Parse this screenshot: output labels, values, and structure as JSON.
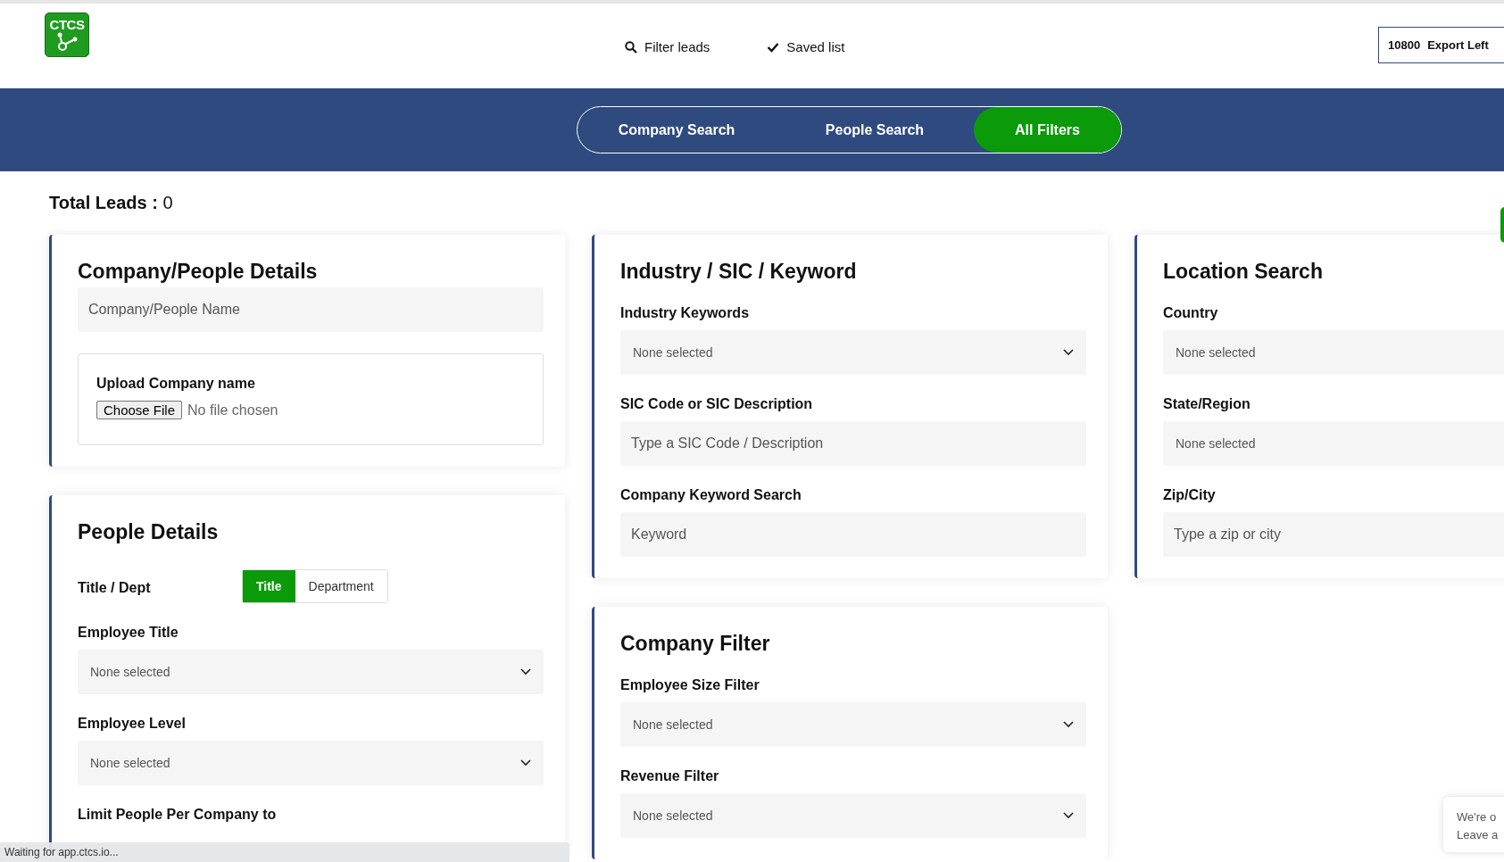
{
  "header": {
    "logo": "CTCS",
    "nav": [
      {
        "label": "Filter leads",
        "kind": "search"
      },
      {
        "label": "Saved list",
        "kind": "check"
      }
    ],
    "export": {
      "count": "10800",
      "label": "Export Left"
    }
  },
  "search_tabs": [
    {
      "label": "Company Search",
      "selected": false
    },
    {
      "label": "People Search",
      "selected": false
    },
    {
      "label": "All Filters",
      "selected": true
    }
  ],
  "total_leads": {
    "label": "Total Leads :",
    "value": "0"
  },
  "columns": [
    [
      {
        "title": "Company/People Details",
        "fields": [
          {
            "kind": "text",
            "placeholder": "Company/People Name"
          },
          {
            "kind": "upload",
            "label": "Upload Company name",
            "button": "Choose File",
            "status": "No file chosen"
          }
        ]
      },
      {
        "title": "People Details",
        "fields": [
          {
            "kind": "toggle",
            "label": "Title / Dept",
            "options": [
              {
                "label": "Title",
                "selected": true
              },
              {
                "label": "Department",
                "selected": false
              }
            ]
          },
          {
            "kind": "select",
            "label": "Employee Title",
            "placeholder": "None selected",
            "caret": true
          },
          {
            "kind": "select",
            "label": "Employee Level",
            "placeholder": "None selected",
            "caret": true
          },
          {
            "kind": "heading",
            "label": "Limit People Per Company to"
          }
        ]
      }
    ],
    [
      {
        "title": "Industry / SIC / Keyword",
        "fields": [
          {
            "kind": "select",
            "label": "Industry Keywords",
            "placeholder": "None selected",
            "caret": true
          },
          {
            "kind": "text",
            "label": "SIC Code or SIC Description",
            "placeholder": "Type a SIC Code / Description"
          },
          {
            "kind": "text",
            "label": "Company Keyword Search",
            "placeholder": "Keyword"
          }
        ]
      },
      {
        "title": "Company Filter",
        "fields": [
          {
            "kind": "select",
            "label": "Employee Size Filter",
            "placeholder": "None selected",
            "caret": true
          },
          {
            "kind": "select",
            "label": "Revenue Filter",
            "placeholder": "None selected",
            "caret": true
          }
        ]
      }
    ],
    [
      {
        "title": "Location Search",
        "fields": [
          {
            "kind": "select",
            "label": "Country",
            "placeholder": "None selected"
          },
          {
            "kind": "select",
            "label": "State/Region",
            "placeholder": "None selected"
          },
          {
            "kind": "text",
            "label": "Zip/City",
            "placeholder": "Type a zip or city"
          }
        ]
      }
    ]
  ],
  "status_bar": "Waiting for app.ctcs.io...",
  "chat_widget": [
    "We're o",
    "Leave a"
  ]
}
